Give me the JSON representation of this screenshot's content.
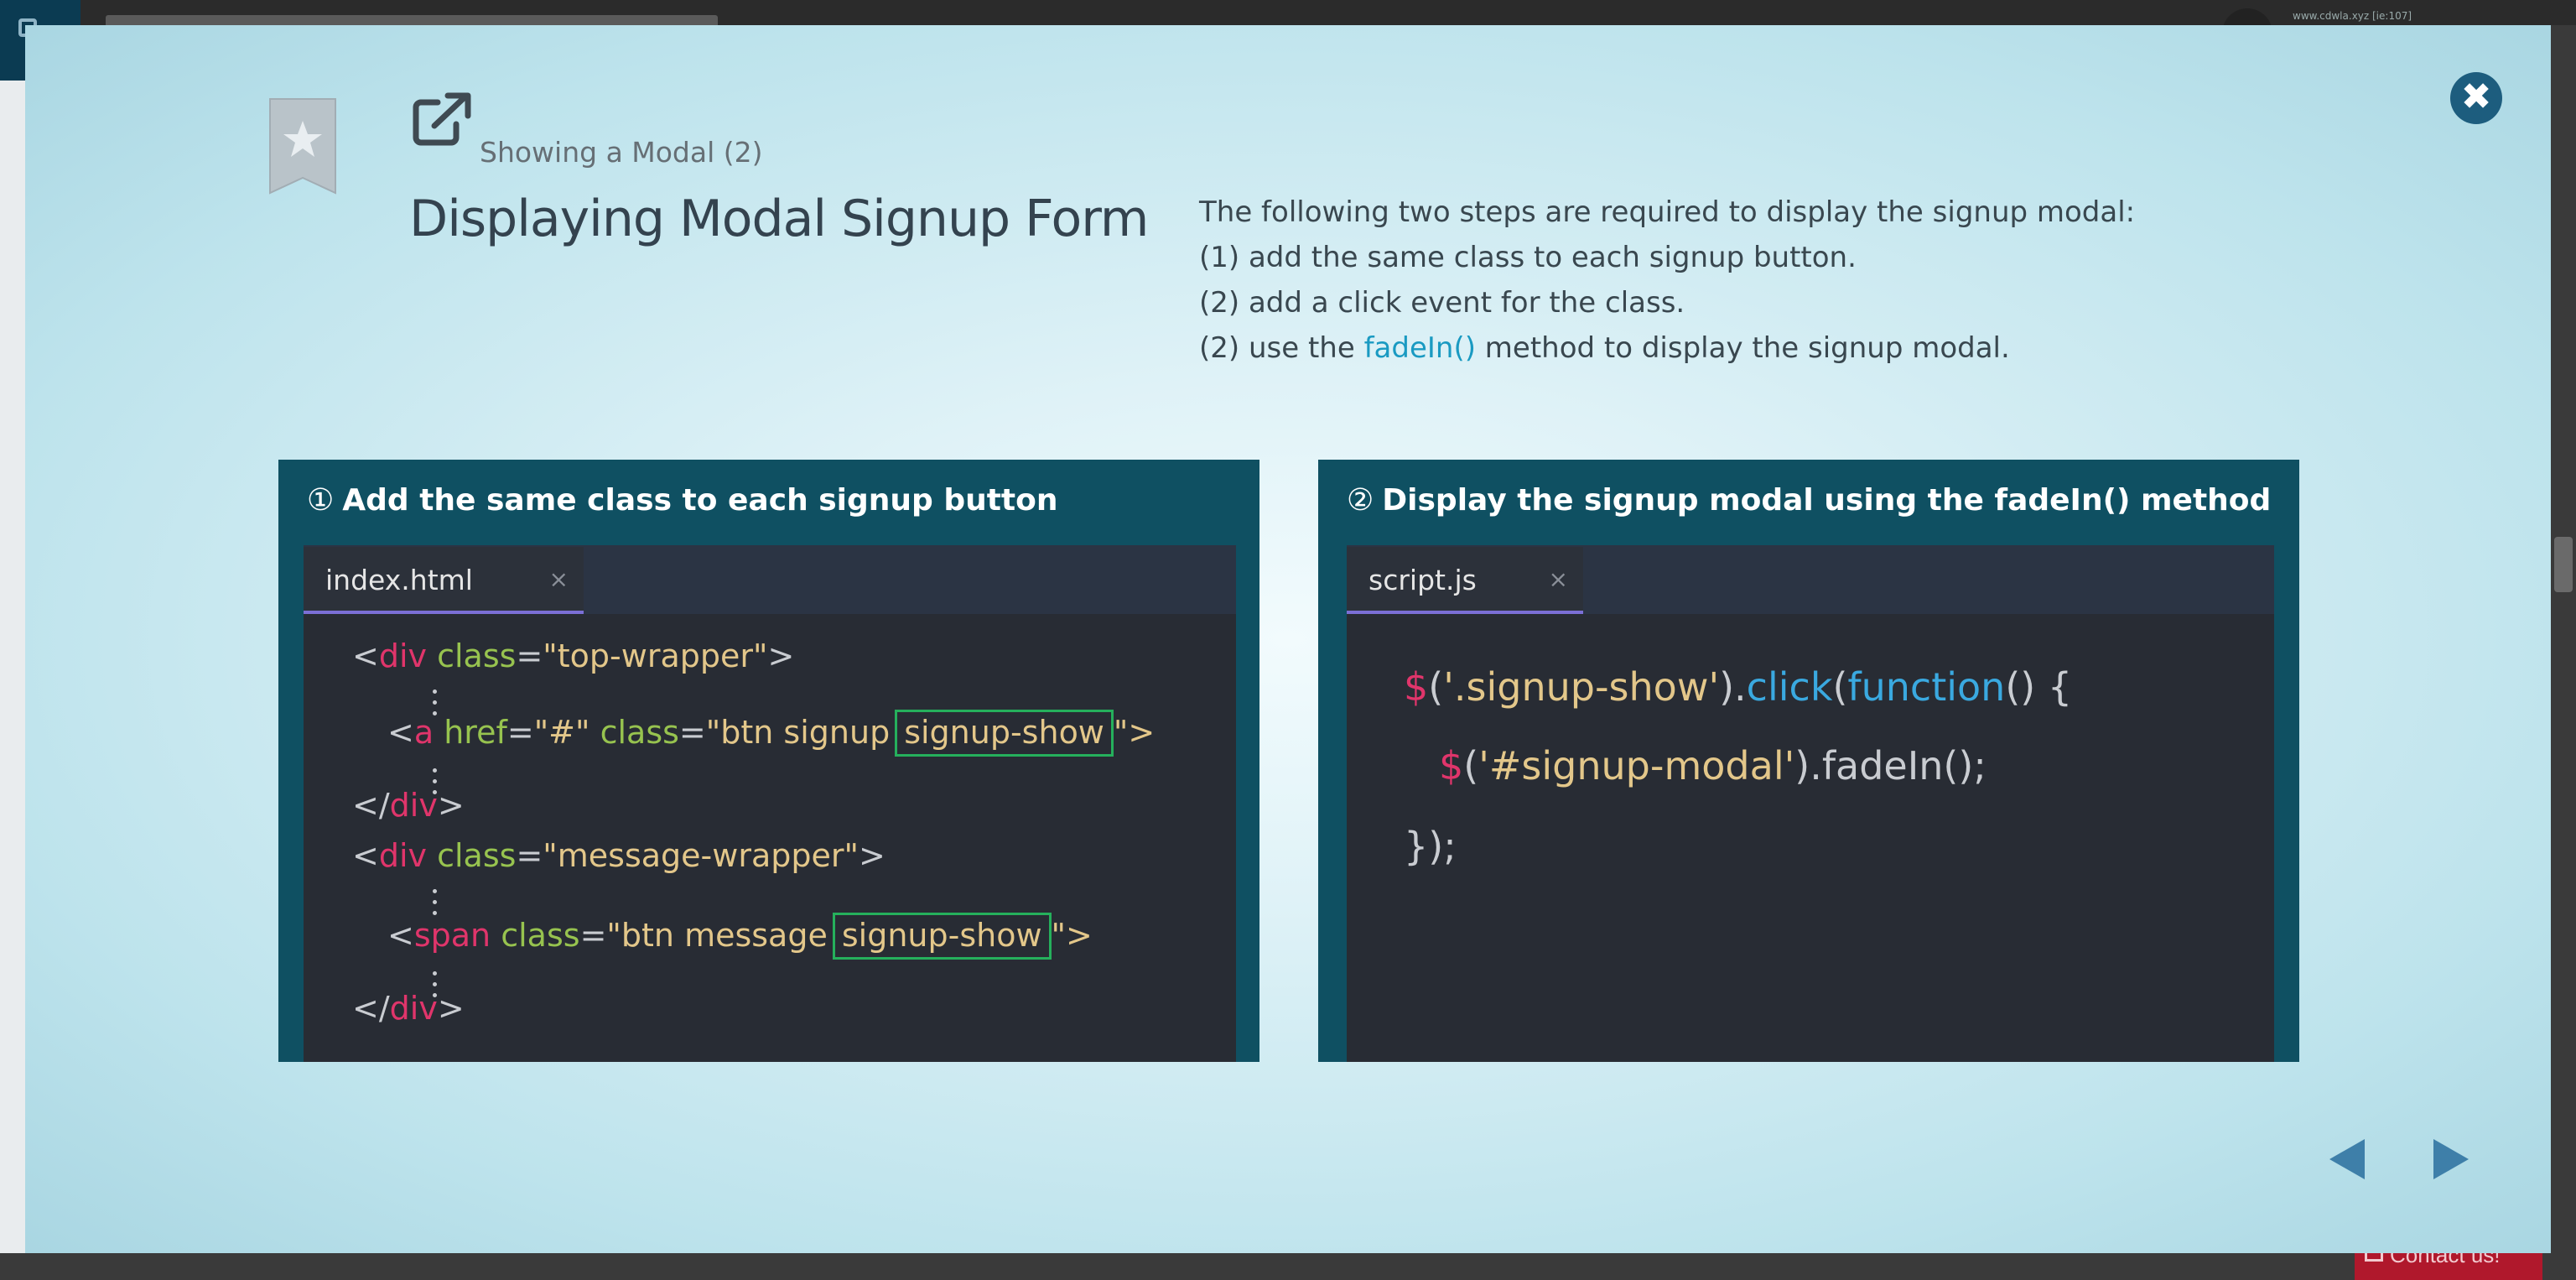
{
  "background": {
    "user_label": "www.cdwla.xyz [ie:107]",
    "contact_label": "Contact us!"
  },
  "modal": {
    "close_icon": "close-icon",
    "bookmark_icon": "bookmark-star-icon",
    "external_icon": "external-link-icon",
    "subtitle": "Showing a Modal (2)",
    "title": "Displaying Modal Signup Form",
    "description": {
      "line1": "The following two steps are required to display the signup modal:",
      "line2": "(1) add the same class to each signup button.",
      "line3": "(2) add a click event for the class.",
      "line4_pre": "(2) use the ",
      "line4_hl": "fadeIn()",
      "line4_post": " method to display the signup modal."
    },
    "panel1": {
      "num": "①",
      "heading": "Add the same class to each signup button",
      "tab": "index.html",
      "tab_close": "×",
      "code": {
        "l1_open": "<",
        "l1_tag": "div",
        "l1_attr": " class",
        "l1_eq": "=",
        "l1_str": "\"top-wrapper\"",
        "l1_close": ">",
        "l2_open": "<",
        "l2_tag": "a",
        "l2_attr1": " href",
        "l2_eq1": "=",
        "l2_str1": "\"#\"",
        "l2_attr2": " class",
        "l2_eq2": "=",
        "l2_str2": "\"btn signup",
        "l2_boxed": "signup-show",
        "l2_end": "\">",
        "l3_open": "</",
        "l3_tag": "div",
        "l3_close": ">",
        "l4_open": "<",
        "l4_tag": "div",
        "l4_attr": " class",
        "l4_eq": "=",
        "l4_str": "\"message-wrapper\"",
        "l4_close": ">",
        "l5_open": "<",
        "l5_tag": "span",
        "l5_attr": " class",
        "l5_eq": "=",
        "l5_str": "\"btn message",
        "l5_boxed": "signup-show",
        "l5_end": "\">",
        "l6_open": "</",
        "l6_tag": "div",
        "l6_close": ">"
      }
    },
    "panel2": {
      "num": "②",
      "heading": "Display the signup modal using the fadeIn() method",
      "tab": "script.js",
      "tab_close": "×",
      "code": {
        "l1_dollar": "$",
        "l1_p1": "(",
        "l1_sel": "'.signup-show'",
        "l1_p2": ").",
        "l1_click": "click",
        "l1_p3": "(",
        "l1_fn": "function",
        "l1_p4": "() {",
        "l2_dollar": "$",
        "l2_p1": "(",
        "l2_sel": "'#signup-modal'",
        "l2_p2": ").fadeIn();",
        "l3": "});"
      }
    },
    "nav": {
      "prev_icon": "triangle-left-icon",
      "next_icon": "triangle-right-icon"
    }
  }
}
